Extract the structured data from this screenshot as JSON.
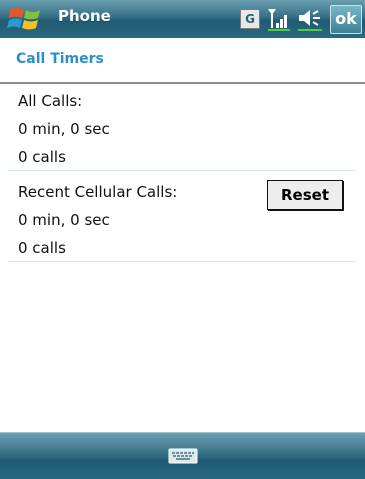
{
  "titlebar": {
    "app_title": "Phone",
    "network_badge": "G",
    "ok_label": "ok",
    "icons": [
      "windows-start-icon",
      "signal-strength-icon",
      "volume-icon"
    ]
  },
  "section": {
    "title": "Call Timers"
  },
  "timers": [
    {
      "label": "All Calls:",
      "duration": "0 min, 0 sec",
      "count": "0 calls"
    },
    {
      "label": "Recent Cellular Calls:",
      "duration": "0 min, 0 sec",
      "count": "0 calls"
    }
  ],
  "reset_label": "Reset",
  "bottombar": {
    "icons": [
      "keyboard-icon"
    ]
  },
  "colors": {
    "accent": "#2d8fc7",
    "titlebar": "#2c6a82",
    "divider": "#cfe6ee"
  }
}
